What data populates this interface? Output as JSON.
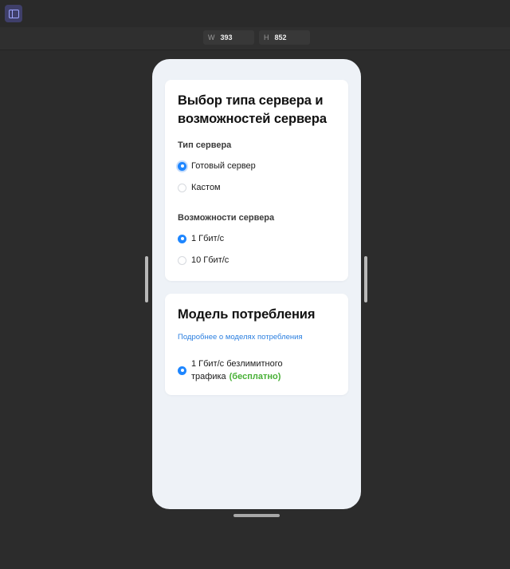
{
  "toolbar": {
    "tool_icon": "frame-tool-icon",
    "cursor_icon": "pointer-cursor-icon"
  },
  "size": {
    "w_label": "W",
    "w_value": "393",
    "h_label": "H",
    "h_value": "852"
  },
  "server_card": {
    "title": "Выбор типа сервера и возможностей сервера",
    "type_label": "Тип сервера",
    "type_options": [
      {
        "label": "Готовый сервер",
        "selected": true
      },
      {
        "label": "Кастом",
        "selected": false
      }
    ],
    "capability_label": "Возможности сервера",
    "capability_options": [
      {
        "label": "1 Гбит/с",
        "selected": true
      },
      {
        "label": "10 Гбит/с",
        "selected": false
      }
    ]
  },
  "model_card": {
    "title": "Модель потребления",
    "link": "Подробнее о моделях потребления",
    "plan_text": "1 Гбит/с безлимитного трафика",
    "plan_badge": "(бесплатно)",
    "plan_selected": true
  },
  "colors": {
    "accent": "#1e86ff",
    "link": "#2b7fe0",
    "free": "#47b035",
    "canvas": "#2c2c2c",
    "phone_bg": "#eef2f7"
  }
}
